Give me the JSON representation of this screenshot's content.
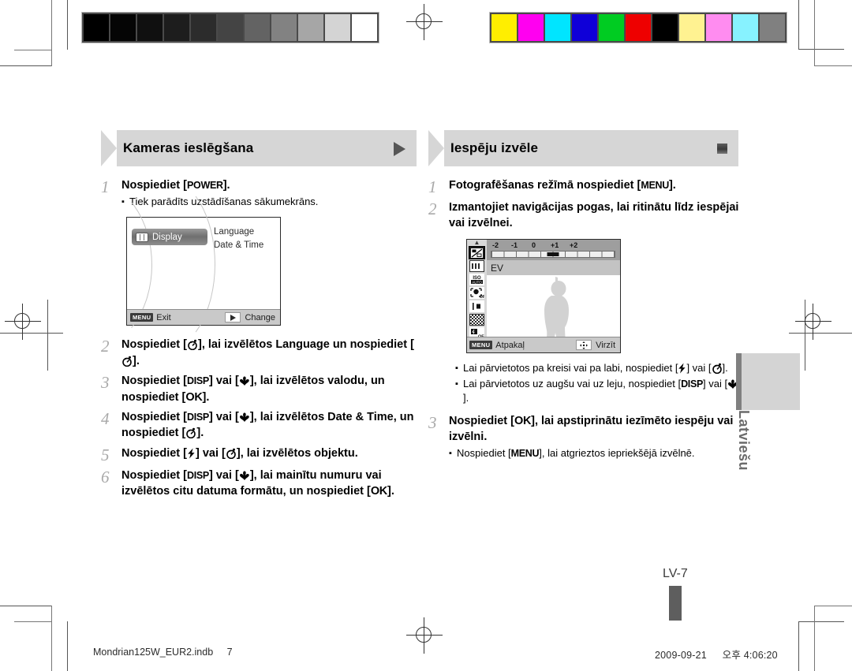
{
  "document": {
    "language_tab": "Latviešu",
    "page_number": "LV-7",
    "footer_file": "Mondrian125W_EUR2.indb",
    "footer_page": "7",
    "footer_date": "2009-09-21",
    "footer_time": "오후 4:06:20"
  },
  "calibration": {
    "gray_swatches": [
      "#000000",
      "#050505",
      "#101010",
      "#1d1d1d",
      "#2c2c2c",
      "#444444",
      "#636363",
      "#828282",
      "#a6a6a6",
      "#d4d4d4",
      "#ffffff"
    ],
    "color_swatches": [
      "#ffee00",
      "#ff00f0",
      "#00e5ff",
      "#0f00d8",
      "#00cc22",
      "#ee0000",
      "#000000",
      "#fff291",
      "#ff8cf0",
      "#87f2ff",
      "#808080"
    ]
  },
  "left_column": {
    "banner_title": "Kameras ieslēgšana",
    "banner_marker": "triangle-right",
    "steps": [
      {
        "num": "1",
        "text_parts": [
          {
            "t": "Nospiediet [",
            "style": "bold"
          },
          {
            "t": "POWER",
            "style": "key"
          },
          {
            "t": "].",
            "style": "bold"
          }
        ],
        "subtext": "Tiek parādīts uzstādīšanas sākumekrāns."
      },
      {
        "num": "2",
        "text_parts": [
          {
            "t": "Nospiediet [",
            "style": "bold"
          },
          {
            "t": "timer-icon",
            "style": "glyph"
          },
          {
            "t": "], lai izvēlētos ",
            "style": "bold"
          },
          {
            "t": "Language",
            "style": "bold"
          },
          {
            "t": " un nospiediet [",
            "style": "bold"
          },
          {
            "t": "timer-icon",
            "style": "glyph"
          },
          {
            "t": "].",
            "style": "bold"
          }
        ]
      },
      {
        "num": "3",
        "text_parts": [
          {
            "t": "Nospiediet [",
            "style": "bold"
          },
          {
            "t": "DISP",
            "style": "key"
          },
          {
            "t": "] vai [",
            "style": "bold"
          },
          {
            "t": "macro-icon",
            "style": "glyph"
          },
          {
            "t": "], lai izvēlētos valodu, un nospiediet [",
            "style": "bold"
          },
          {
            "t": "OK",
            "style": "key"
          },
          {
            "t": "].",
            "style": "bold"
          }
        ]
      },
      {
        "num": "4",
        "text_parts": [
          {
            "t": "Nospiediet [",
            "style": "bold"
          },
          {
            "t": "DISP",
            "style": "key"
          },
          {
            "t": "] vai [",
            "style": "bold"
          },
          {
            "t": "macro-icon",
            "style": "glyph"
          },
          {
            "t": "], lai izvēlētos ",
            "style": "bold"
          },
          {
            "t": "Date & Time",
            "style": "bold"
          },
          {
            "t": ", un nospiediet [",
            "style": "bold"
          },
          {
            "t": "timer-icon",
            "style": "glyph"
          },
          {
            "t": "].",
            "style": "bold"
          }
        ]
      },
      {
        "num": "5",
        "text_parts": [
          {
            "t": "Nospiediet [",
            "style": "bold"
          },
          {
            "t": "flash-icon",
            "style": "glyph"
          },
          {
            "t": "] vai [",
            "style": "bold"
          },
          {
            "t": "timer-icon",
            "style": "glyph"
          },
          {
            "t": "], lai izvēlētos objektu.",
            "style": "bold"
          }
        ]
      },
      {
        "num": "6",
        "text_parts": [
          {
            "t": "Nospiediet [",
            "style": "bold"
          },
          {
            "t": "DISP",
            "style": "key"
          },
          {
            "t": "] vai [",
            "style": "bold"
          },
          {
            "t": "macro-icon",
            "style": "glyph"
          },
          {
            "t": "], lai mainītu numuru vai izvēlētos citu datuma formātu, un nospiediet [",
            "style": "bold"
          },
          {
            "t": "OK",
            "style": "key"
          },
          {
            "t": "].",
            "style": "bold"
          }
        ]
      }
    ],
    "lcd": {
      "tab_label": "Display",
      "tab_icon": "display-icon",
      "menu_items": [
        "Language",
        "Date & Time"
      ],
      "footer_key": "MENU",
      "footer_left_label": "Exit",
      "footer_right_label": "Change"
    }
  },
  "right_column": {
    "banner_title": "Iespēju izvēle",
    "banner_marker": "square",
    "steps": [
      {
        "num": "1",
        "text_parts": [
          {
            "t": "Fotografēšanas režīmā nospiediet [",
            "style": "bold"
          },
          {
            "t": "MENU",
            "style": "key"
          },
          {
            "t": "].",
            "style": "bold"
          }
        ]
      },
      {
        "num": "2",
        "text_parts": [
          {
            "t": "Izmantojiet navigācijas pogas, lai ritinātu līdz iespējai vai izvēlnei.",
            "style": "bold"
          }
        ]
      },
      {
        "num": "3",
        "text_parts": [
          {
            "t": "Nospiediet [",
            "style": "bold"
          },
          {
            "t": "OK",
            "style": "key"
          },
          {
            "t": "], lai apstiprinātu iezīmēto iespēju vai izvēlni.",
            "style": "bold"
          }
        ],
        "subtext_parts": [
          {
            "t": "Nospiediet [",
            "style": "normal"
          },
          {
            "t": "MENU",
            "style": "key"
          },
          {
            "t": "], lai atgrieztos iepriekšējā izvēlnē.",
            "style": "normal"
          }
        ]
      }
    ],
    "bullets": [
      [
        {
          "t": "Lai pārvietotos pa kreisi vai pa labi, nospiediet [",
          "style": "normal"
        },
        {
          "t": "flash-icon",
          "style": "glyph"
        },
        {
          "t": "] vai [",
          "style": "normal"
        },
        {
          "t": "timer-icon",
          "style": "glyph"
        },
        {
          "t": "].",
          "style": "normal"
        }
      ],
      [
        {
          "t": "Lai pārvietotos uz augšu vai uz leju, nospiediet [",
          "style": "normal"
        },
        {
          "t": "DISP",
          "style": "key"
        },
        {
          "t": "] vai [",
          "style": "normal"
        },
        {
          "t": "macro-icon",
          "style": "glyph"
        },
        {
          "t": "].",
          "style": "normal"
        }
      ]
    ],
    "lcd": {
      "ev_scale_labels": [
        "-2",
        "-1",
        "0",
        "+1",
        "+2"
      ],
      "ev_value_label": "EV",
      "sidebar_icons": [
        "ev-icon",
        "battery-icon",
        "iso-auto-icon",
        "face-detect-off-icon",
        "focus-icon",
        "image-quality-icon",
        "flash-off-icon"
      ],
      "footer_key": "MENU",
      "footer_left_label": "Atpakaļ",
      "footer_right_label": "Virzīt",
      "dpad_icon": "dpad-icon"
    }
  }
}
